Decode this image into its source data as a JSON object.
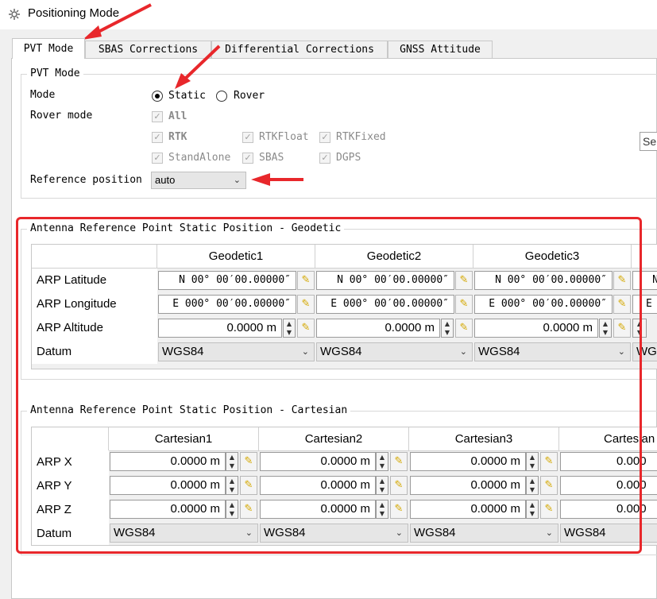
{
  "window": {
    "title": "Positioning Mode"
  },
  "tabs": [
    {
      "label": "PVT Mode"
    },
    {
      "label": "SBAS Corrections"
    },
    {
      "label": "Differential Corrections"
    },
    {
      "label": "GNSS Attitude"
    }
  ],
  "pvt": {
    "group_title": "PVT Mode",
    "mode_label": "Mode",
    "mode_options": [
      "Static",
      "Rover"
    ],
    "rover_mode_label": "Rover mode",
    "rover_checks": [
      "All",
      "RTK",
      "RTKFloat",
      "RTKFixed",
      "StandAlone",
      "SBAS",
      "DGPS"
    ],
    "reference_position_label": "Reference position",
    "reference_position_value": "auto",
    "side_button_partial": "Se"
  },
  "geodetic": {
    "group_title": "Antenna Reference Point Static Position - Geodetic",
    "columns": [
      "Geodetic1",
      "Geodetic2",
      "Geodetic3",
      ""
    ],
    "rows": {
      "latitude": {
        "label": "ARP Latitude",
        "values": [
          "N 00° 00′00.00000″",
          "N 00° 00′00.00000″",
          "N 00° 00′00.00000″",
          "N"
        ]
      },
      "longitude": {
        "label": "ARP Longitude",
        "values": [
          "E 000° 00′00.00000″",
          "E 000° 00′00.00000″",
          "E 000° 00′00.00000″",
          "E"
        ]
      },
      "altitude": {
        "label": "ARP Altitude",
        "values": [
          "0.0000 m",
          "0.0000 m",
          "0.0000 m"
        ]
      },
      "datum": {
        "label": "Datum",
        "values": [
          "WGS84",
          "WGS84",
          "WGS84",
          "WG"
        ]
      }
    }
  },
  "cartesian": {
    "group_title": "Antenna Reference Point Static Position - Cartesian",
    "columns": [
      "Cartesian1",
      "Cartesian2",
      "Cartesian3",
      "Cartesian"
    ],
    "rows": {
      "x": {
        "label": "ARP X",
        "values": [
          "0.0000 m",
          "0.0000 m",
          "0.0000 m",
          "0.000"
        ]
      },
      "y": {
        "label": "ARP Y",
        "values": [
          "0.0000 m",
          "0.0000 m",
          "0.0000 m",
          "0.000"
        ]
      },
      "z": {
        "label": "ARP Z",
        "values": [
          "0.0000 m",
          "0.0000 m",
          "0.0000 m",
          "0.000"
        ]
      },
      "datum": {
        "label": "Datum",
        "values": [
          "WGS84",
          "WGS84",
          "WGS84",
          "WGS84"
        ]
      }
    }
  },
  "colors": {
    "annotation": "#e8272b",
    "edit_icon": "#d4a800"
  },
  "icons": {
    "app": "gear-icon",
    "edit": "pencil-icon",
    "dropdown": "chevron-down-icon",
    "spin": "spin-arrows-icon"
  }
}
